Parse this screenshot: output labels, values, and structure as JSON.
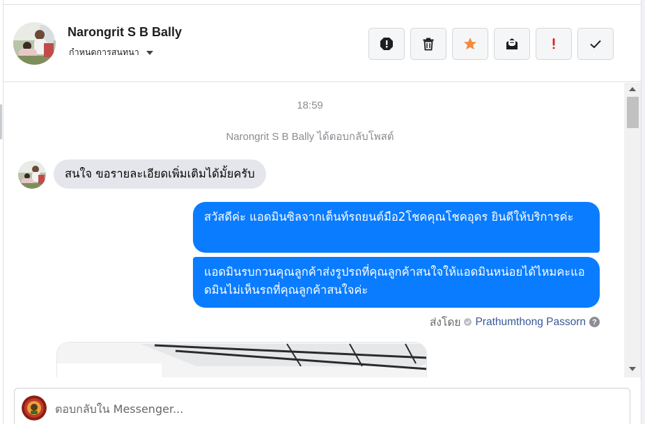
{
  "header": {
    "contact_name": "Narongrit S B Bally",
    "label_action": "กำหนดการสนทนา",
    "toolbar": [
      {
        "name": "spam-button",
        "icon": "exclamation-octagon-icon"
      },
      {
        "name": "delete-button",
        "icon": "trash-icon"
      },
      {
        "name": "star-button",
        "icon": "star-icon"
      },
      {
        "name": "mark-unread-button",
        "icon": "envelope-open-icon"
      },
      {
        "name": "follow-up-button",
        "icon": "exclamation-icon"
      },
      {
        "name": "mark-done-button",
        "icon": "checkmark-icon"
      }
    ]
  },
  "conversation": {
    "timestamp": "18:59",
    "system_note": "Narongrit S B Bally ได้ตอบกลับโพสต์",
    "incoming_message": "สนใจ ขอรายละเอียดเพิ่มเติมได้มั้ยครับ",
    "outgoing_messages": [
      "สวัสดีค่ะ แอดมินซิลจากเต็นท์รถยนต์มือ2โชคคุณโชคอุดร ยินดีให้บริการค่ะ",
      "แอดมินรบกวนคุณลูกค้าส่งรูปรถที่คุณลูกค้าสนใจให้แอดมินหน่อยได้ไหมคะแอดมินไม่เห็นรถที่คุณลูกค้าสนใจค่ะ"
    ],
    "sent_by_label": "ส่งโดย",
    "sender_name": "Prathumthong Passorn"
  },
  "composer": {
    "placeholder": "ตอบกลับใน Messenger..."
  },
  "colors": {
    "outgoing_bubble": "#0a7cff",
    "incoming_bubble": "#e4e6eb",
    "star": "#f5893c",
    "follow_up": "#e02020",
    "sender_link": "#385898"
  }
}
